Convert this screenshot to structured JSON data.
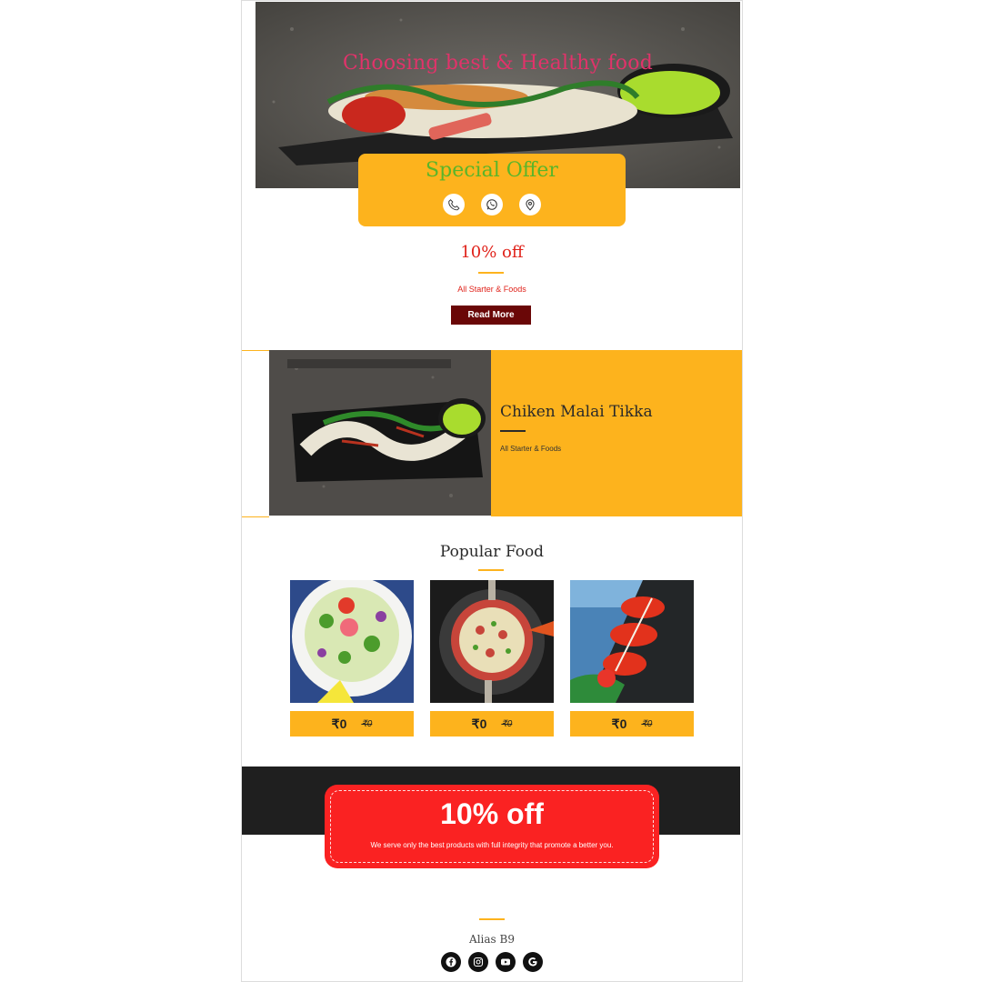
{
  "hero": {
    "headline": "Choosing best & Healthy food",
    "image_icon": "hero-food-photo"
  },
  "offer_card": {
    "title": "Special Offer",
    "icons": [
      "phone-icon",
      "whatsapp-icon",
      "location-pin-icon"
    ]
  },
  "discount": {
    "title": "10% off",
    "subtitle": "All Starter & Foods",
    "button_label": "Read More"
  },
  "feature": {
    "title": "Chiken Malai Tikka",
    "subtitle": "All Starter & Foods"
  },
  "popular": {
    "title": "Popular Food",
    "items": [
      {
        "price": "₹0",
        "old_price": "₹0"
      },
      {
        "price": "₹0",
        "old_price": "₹0"
      },
      {
        "price": "₹0",
        "old_price": "₹0"
      }
    ]
  },
  "promo": {
    "title": "10% off",
    "text": "We serve only the best products with full integrity that promote a better you."
  },
  "footer": {
    "name": "Alias B9",
    "social": [
      "facebook-icon",
      "instagram-icon",
      "youtube-icon",
      "google-icon"
    ]
  },
  "colors": {
    "accent_yellow": "#fdb31d",
    "promo_red": "#fa2222",
    "button_dark_red": "#6a0707",
    "hero_title_pink": "#e0336a",
    "offer_green": "#5ab52a"
  }
}
